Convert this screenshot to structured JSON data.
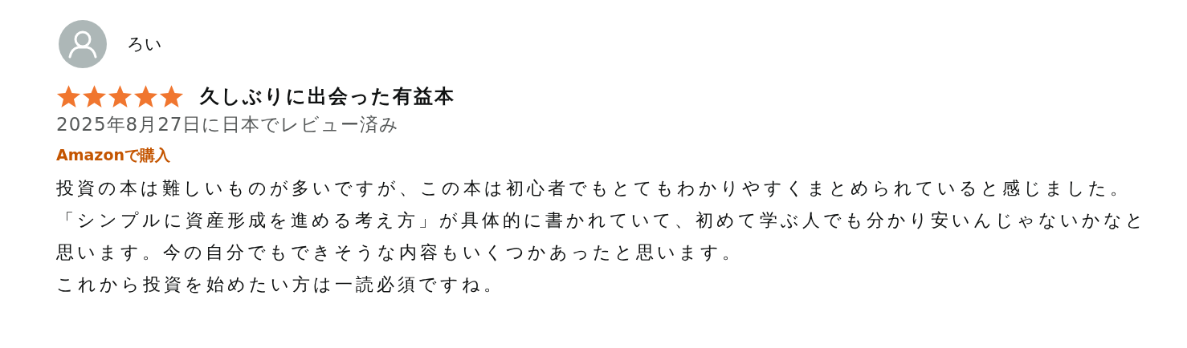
{
  "review": {
    "author": "ろい",
    "stars": 5,
    "title": "久しぶりに出会った有益本",
    "date": "2025年8月27日に日本でレビュー済み",
    "badge": "Amazonで購入",
    "paragraphs": [
      "投資の本は難しいものが多いですが、この本は初心者でもとてもわかりやすくまとめられていると感じました。",
      "「シンプルに資産形成を進める考え方」が具体的に書かれていて、初めて学ぶ人でも分かり安いんじゃないかなと思います。今の自分でもできそうな内容もいくつかあったと思います。",
      "これから投資を始めたい方は一読必須ですね。"
    ]
  }
}
